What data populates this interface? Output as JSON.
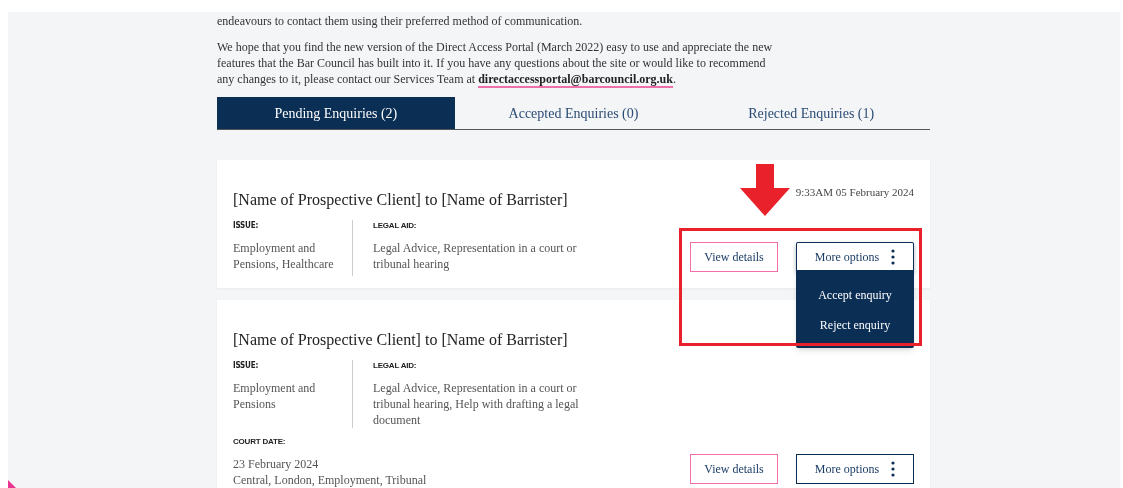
{
  "intro": {
    "lead": "endeavours to contact them using their preferred method of communication.",
    "text_before": "We hope that you find the new version of the Direct Access Portal (March 2022) easy to use and appreciate the new features that the Bar Council has built into it. If you have any questions about the site or would like to recommend any changes to it, please contact our Services Team at ",
    "link": "directaccessportal@barcouncil.org.uk",
    "text_after": "."
  },
  "tabs": [
    {
      "label": "Pending Enquiries (2)",
      "selected": true
    },
    {
      "label": "Accepted Enquiries (0)",
      "selected": false
    },
    {
      "label": "Rejected Enquiries (1)",
      "selected": false
    }
  ],
  "enquiries": [
    {
      "title": "[Name of Prospective Client] to [Name of Barrister]",
      "timestamp": "9:33AM 05 February 2024",
      "issue_label": "ISSUE:",
      "issue": "Employment and Pensions, Healthcare",
      "legal_aid_label": "LEGAL AID:",
      "legal_aid": "Legal Advice, Representation in a court or tribunal hearing",
      "view_button": "View details",
      "options_button": "More options",
      "menu_open": true,
      "menu": [
        "Accept enquiry",
        "Reject enquiry"
      ]
    },
    {
      "title": "[Name of Prospective Client] to [Name of Barrister]",
      "issue_label": "ISSUE:",
      "issue": "Employment and Pensions",
      "legal_aid_label": "LEGAL AID:",
      "legal_aid": "Legal Advice, Representation in a court or tribunal hearing, Help with drafting a legal document",
      "court_date_label": "COURT DATE:",
      "court_date": "23 February 2024",
      "court_location": "Central, London, Employment, Tribunal",
      "view_button": "View details",
      "options_button": "More options",
      "menu_open": false
    }
  ]
}
